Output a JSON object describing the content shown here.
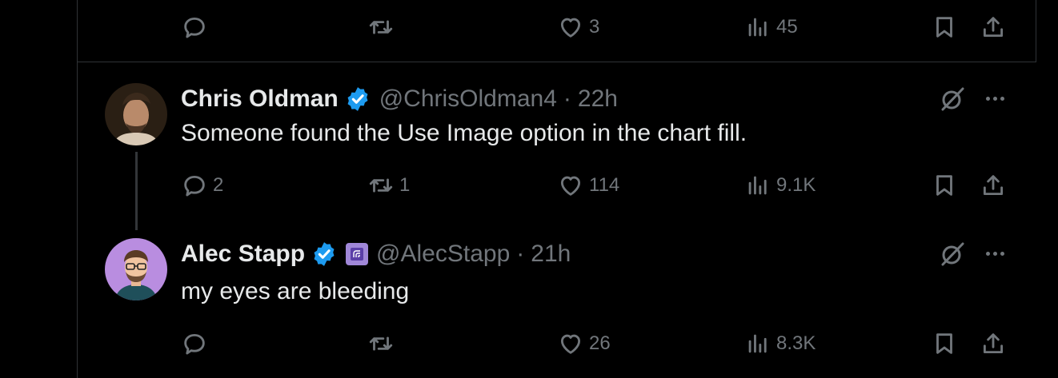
{
  "top_tweet": {
    "actions": {
      "replies": "",
      "retweets": "",
      "likes": "3",
      "views": "45"
    }
  },
  "reply1": {
    "author_name": "Chris Oldman",
    "handle": "@ChrisOldman4",
    "separator": "·",
    "time": "22h",
    "text": "Someone found the Use Image option in the chart fill.",
    "actions": {
      "replies": "2",
      "retweets": "1",
      "likes": "114",
      "views": "9.1K"
    }
  },
  "reply2": {
    "author_name": "Alec Stapp",
    "handle": "@AlecStapp",
    "separator": "·",
    "time": "21h",
    "text": "my eyes are bleeding",
    "actions": {
      "replies": "",
      "retweets": "",
      "likes": "26",
      "views": "8.3K"
    }
  },
  "colors": {
    "background": "#000000",
    "text": "#e7e9ea",
    "muted": "#71767b",
    "verified": "#1d9bf0",
    "border": "#2f3336"
  },
  "icons": [
    "reply-icon",
    "retweet-icon",
    "like-icon",
    "views-icon",
    "bookmark-icon",
    "share-icon",
    "verified-badge-icon",
    "grok-icon",
    "more-icon"
  ]
}
